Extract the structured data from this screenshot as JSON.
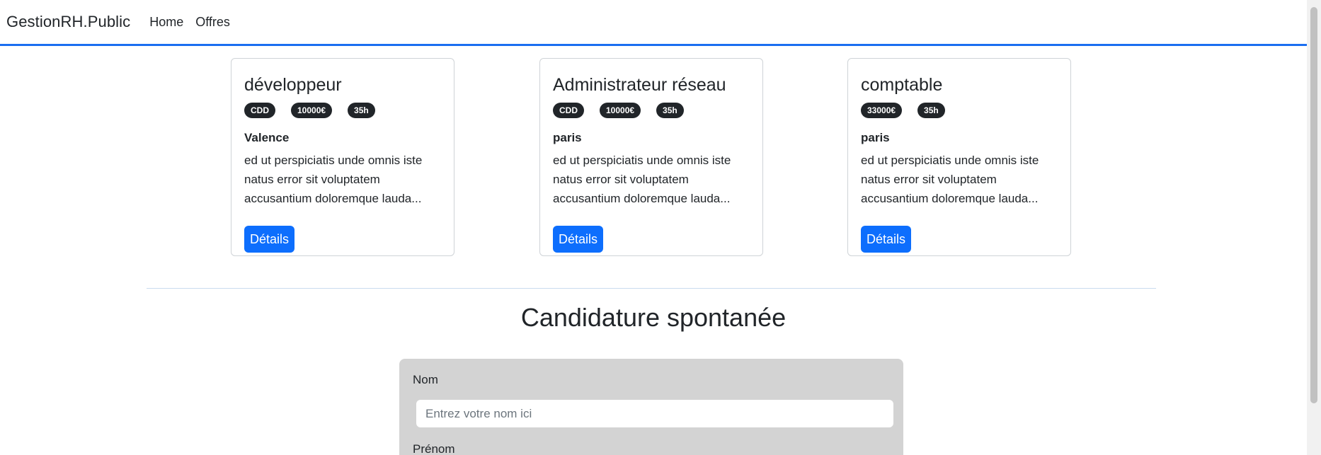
{
  "navbar": {
    "brand": "GestionRH.Public",
    "links": [
      "Home",
      "Offres"
    ],
    "accent_color": "#1a6ef0"
  },
  "offers": [
    {
      "title": "développeur",
      "badges": [
        "CDD",
        "10000€",
        "35h"
      ],
      "location": "Valence",
      "description_lines": [
        "ed ut perspiciatis unde omnis iste",
        "natus error sit voluptatem",
        "accusantium doloremque lauda..."
      ],
      "button": "Détails"
    },
    {
      "title": "Administrateur réseau",
      "badges": [
        "CDD",
        "10000€",
        "35h"
      ],
      "location": "paris",
      "description_lines": [
        "ed ut perspiciatis unde omnis iste",
        "natus error sit voluptatem",
        "accusantium doloremque lauda..."
      ],
      "button": "Détails"
    },
    {
      "title": "comptable",
      "badges": [
        "33000€",
        "35h"
      ],
      "location": "paris",
      "description_lines": [
        "ed ut perspiciatis unde omnis iste",
        "natus error sit voluptatem",
        "accusantium doloremque lauda..."
      ],
      "button": "Détails"
    }
  ],
  "application": {
    "title": "Candidature spontanée",
    "nom_label": "Nom",
    "nom_placeholder": "Entrez votre nom ici",
    "prenom_label": "Prénom"
  },
  "colors": {
    "primary": "#0d6efd",
    "badge": "#212529",
    "form_bg": "#d3d3d3"
  }
}
